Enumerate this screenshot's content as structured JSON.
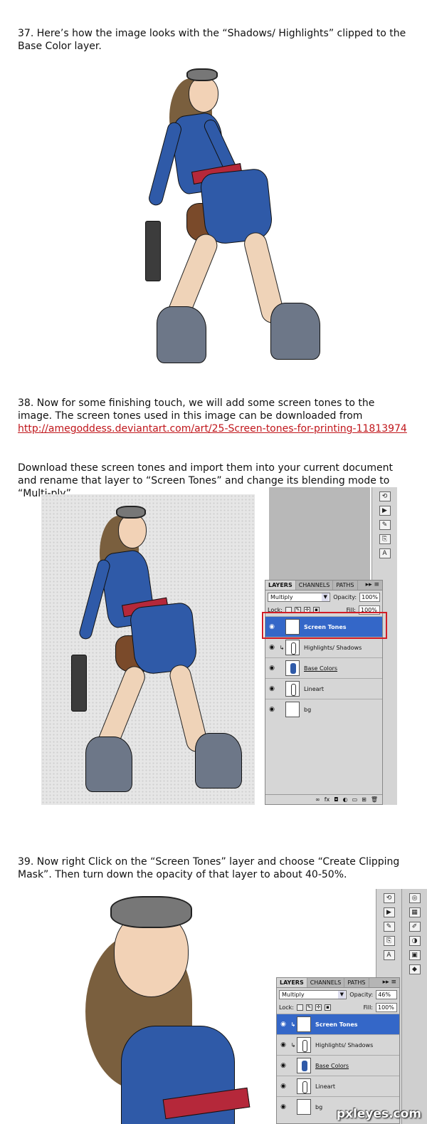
{
  "step37": {
    "text": "37. Here’s how the image looks with the “Shadows/ Highlights” clipped to the Base Color layer."
  },
  "step38": {
    "text": "38. Now for some finishing touch, we will add some screen tones to the image. The screen tones used in this image can be downloaded from",
    "link": "http://amegoddess.deviantart.com/art/25-Screen-tones-for-printing-11813974",
    "text2": "Download these screen tones and import them into your current document and rename that layer to “Screen Tones” and change its blending mode to “Multi-ply”."
  },
  "step39": {
    "text": "39. Now right Click on the “Screen Tones” layer and choose “Create Clipping Mask”. Then turn down the opacity of that layer to about 40-50%."
  },
  "panel1": {
    "tabs": [
      "LAYERS",
      "CHANNELS",
      "PATHS"
    ],
    "blend_mode": "Multiply",
    "opacity_label": "Opacity:",
    "opacity": "100%",
    "lock_label": "Lock:",
    "fill_label": "Fill:",
    "fill": "100%",
    "layers": [
      {
        "name": "Screen Tones",
        "selected": true
      },
      {
        "name": "Highlights/ Shadows",
        "selected": false
      },
      {
        "name": "Base Colors",
        "selected": false
      },
      {
        "name": "Lineart",
        "selected": false
      },
      {
        "name": "bg",
        "selected": false
      }
    ]
  },
  "panel2": {
    "tabs": [
      "LAYERS",
      "CHANNELS",
      "PATHS"
    ],
    "blend_mode": "Multiply",
    "opacity_label": "Opacity:",
    "opacity": "46%",
    "lock_label": "Lock:",
    "fill_label": "Fill:",
    "fill": "100%",
    "layers": [
      {
        "name": "Screen Tones",
        "selected": true
      },
      {
        "name": "Highlights/ Shadows",
        "selected": false
      },
      {
        "name": "Base Colors",
        "selected": false
      },
      {
        "name": "Lineart",
        "selected": false
      },
      {
        "name": "bg",
        "selected": false
      }
    ]
  },
  "watermark": "pxleyes.com",
  "colors": {
    "link": "#c0161b",
    "selection": "#3467c8",
    "highlight_box": "#d11d26",
    "suit_blue": "#2f5aa8"
  }
}
